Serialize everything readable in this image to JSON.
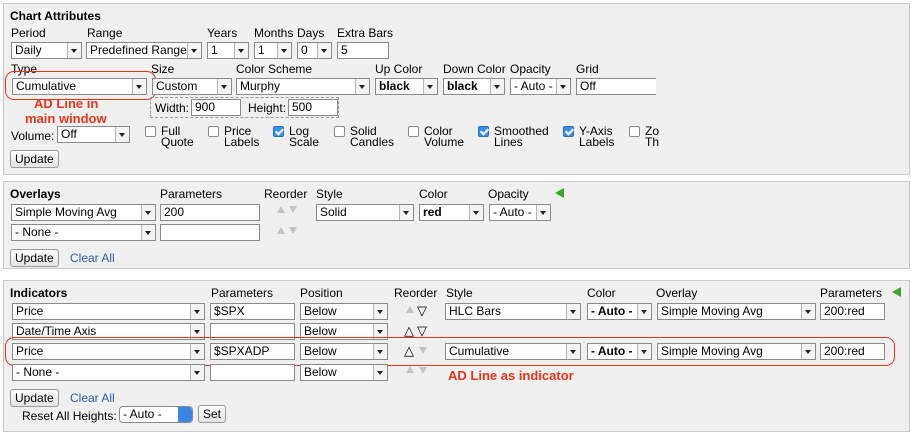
{
  "chart_attributes": {
    "title": "Chart Attributes",
    "labels": {
      "period": "Period",
      "range": "Range",
      "years": "Years",
      "months": "Months",
      "days": "Days",
      "extra_bars": "Extra Bars",
      "type": "Type",
      "size": "Size",
      "color_scheme": "Color Scheme",
      "up_color": "Up Color",
      "down_color": "Down Color",
      "opacity": "Opacity",
      "grid": "Grid",
      "width": "Width:",
      "height": "Height:",
      "volume": "Volume:"
    },
    "values": {
      "period": "Daily",
      "range": "Predefined Range",
      "years": "1",
      "months": "1",
      "days": "0",
      "extra_bars": "5",
      "type": "Cumulative",
      "size": "Custom",
      "color_scheme": "Murphy",
      "up_color": "black",
      "down_color": "black",
      "opacity": "- Auto -",
      "grid": "Off",
      "width": "900",
      "height": "500",
      "volume": "Off"
    },
    "checkboxes": [
      {
        "l1": "Full",
        "l2": "Quote",
        "checked": false
      },
      {
        "l1": "Price",
        "l2": "Labels",
        "checked": false
      },
      {
        "l1": "Log",
        "l2": "Scale",
        "checked": true
      },
      {
        "l1": "Solid",
        "l2": "Candles",
        "checked": false
      },
      {
        "l1": "Color",
        "l2": "Volume",
        "checked": false
      },
      {
        "l1": "Smoothed",
        "l2": "Lines",
        "checked": true
      },
      {
        "l1": "Y-Axis",
        "l2": "Labels",
        "checked": true
      },
      {
        "l1": "Zo",
        "l2": "Th",
        "checked": false
      }
    ],
    "update_label": "Update"
  },
  "annotations": {
    "main_line1": "AD Line in",
    "main_line2": "main window",
    "indicator": "AD Line as indicator",
    "color": "#e5361b"
  },
  "overlays": {
    "title": "Overlays",
    "labels": {
      "parameters": "Parameters",
      "reorder": "Reorder",
      "style": "Style",
      "color": "Color",
      "opacity": "Opacity"
    },
    "rows": [
      {
        "overlay": "Simple Moving Avg",
        "params": "200",
        "style": "Solid",
        "color": "red",
        "opacity": "- Auto -"
      },
      {
        "overlay": "- None -",
        "params": ""
      }
    ],
    "update_label": "Update",
    "clear_label": "Clear All"
  },
  "indicators": {
    "title": "Indicators",
    "labels": {
      "parameters": "Parameters",
      "position": "Position",
      "reorder": "Reorder",
      "style": "Style",
      "color": "Color",
      "overlay": "Overlay",
      "parameters2": "Parameters"
    },
    "rows": [
      {
        "indicator": "Price",
        "params": "$SPX",
        "position": "Below",
        "style": "HLC Bars",
        "color": "- Auto -",
        "overlay": "Simple Moving Avg",
        "oparams": "200:red"
      },
      {
        "indicator": "Date/Time Axis",
        "params": "",
        "position": "Below"
      },
      {
        "indicator": "Price",
        "params": "$SPXADP",
        "position": "Below",
        "style": "Cumulative",
        "color": "- Auto -",
        "overlay": "Simple Moving Avg",
        "oparams": "200:red"
      },
      {
        "indicator": "- None -",
        "params": "",
        "position": "Below"
      }
    ],
    "update_label": "Update",
    "clear_label": "Clear All",
    "reset_label": "Reset All Heights:",
    "reset_value": "- Auto -",
    "set_label": "Set"
  }
}
